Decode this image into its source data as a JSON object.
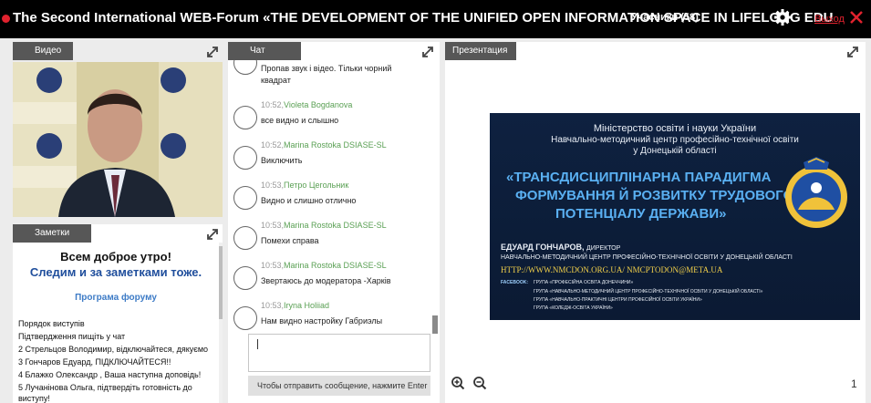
{
  "header": {
    "title": "The Second International WEB-Forum «THE DEVELOPMENT OF THE UNIFIED OPEN INFORMATION SPACE IN LIFELONG EDU",
    "participants": "Учасники (58)",
    "exit_label": "Выход"
  },
  "video": {
    "tab_label": "Видео"
  },
  "notes": {
    "tab_label": "Заметки",
    "heading1": "Всем доброе утро!",
    "heading2": "Следим и за заметками тоже.",
    "program_link": "Програма форуму",
    "lines": [
      "Порядок виступів",
      "Підтвердження пищіть у чат",
      "2 Стрельцов Володимир, відключайтеся, дякуємо",
      "3 Гончаров Едуард, ПІДКЛЮЧАЙТЕСЯ!!",
      "4 Блажко Олександр , Ваша наступна доповідь!",
      "5 Лучанінова Ольга, підтвердіть готовність до",
      "виступу!"
    ]
  },
  "chat": {
    "tab_label": "Чат",
    "input_placeholder": "Чтобы отправить сообщение, нажмите Enter",
    "first_text_1": "Пропав звук і відео. Тільки чорний",
    "first_text_2": "квадрат",
    "messages": [
      {
        "time": "10:52,",
        "name": "Violeta Bogdanova",
        "text": "все видно и слышно"
      },
      {
        "time": "10:52,",
        "name": "Marina Rostoka DSIASE-SL",
        "text": "Виключить"
      },
      {
        "time": "10:53,",
        "name": "Петро Цегольник",
        "text": "Видно и слишно отлично"
      },
      {
        "time": "10:53,",
        "name": "Marina Rostoka DSIASE-SL",
        "text": "Помехи справа"
      },
      {
        "time": "10:53,",
        "name": "Marina Rostoka DSIASE-SL",
        "text": "Звертаюсь до модератора -Харків"
      },
      {
        "time": "10:53,",
        "name": "Iryna Holiiad",
        "text": "Нам видно настройку Габриэлы"
      }
    ]
  },
  "presentation": {
    "tab_label": "Презентация",
    "page_number": "1",
    "slide": {
      "ministry": "Міністерство освіти і науки України",
      "center_1": "Навчально-методичний центр професійно-технічної освіти",
      "center_2": "у Донецькій області",
      "title_1": "«ТРАНСДИСЦИПЛІНАРНА ПАРАДИГМА",
      "title_2": "ФОРМУВАННЯ Й РОЗВИТКУ ТРУДОВОГО",
      "title_3": "ПОТЕНЦІАЛУ ДЕРЖАВИ»",
      "author": "ЕДУАРД ГОНЧАРОВ,",
      "author_role": "ДИРЕКТОР",
      "author_org": "НАВЧАЛЬНО-МЕТОДИЧНИЙ ЦЕНТР ПРОФЕСІЙНО-ТЕХНІЧНОЇ ОСВІТИ У ДОНЕЦЬКІЙ ОБЛАСТІ",
      "url": "HTTP://WWW.NMCDON.ORG.UA/ NMCPTODON@META.UA",
      "facebook": "FACEBOOK:",
      "group_1": "ГРУПА «ПРОФЕСІЙНА ОСВІТА ДОНЕЧЧИНИ»",
      "group_2": "ГРУПА «НАВЧАЛЬНО-МЕТОДИЧНИЙ ЦЕНТР ПРОФЕСІЙНО-ТЕХНІЧНОЇ ОСВІТИ У ДОНЕЦЬКІЙ ОБЛАСТІ»",
      "group_3": "ГРУПА «НАВЧАЛЬНО-ПРАКТИЧНІ ЦЕНТРИ ПРОФЕСІЙНОЇ ОСВІТИ УКРАЇНИ»",
      "group_4": "ГРУПА «КОЛЕДЖ-ОСВІТА УКРАЇНИ»",
      "logo_text": "НМЦ ПТО у Донецькій області"
    }
  }
}
